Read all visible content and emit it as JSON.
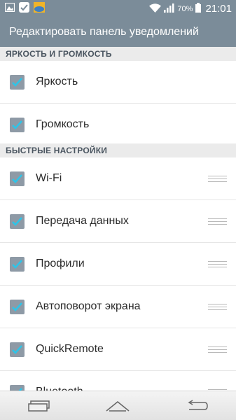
{
  "status_bar": {
    "battery": "70%",
    "time": "21:01",
    "left_icons": [
      "gallery-icon",
      "checkmark-app-icon",
      "weather-icon"
    ],
    "right_icons": [
      "wifi-icon",
      "signal-icon",
      "battery-icon"
    ]
  },
  "header": {
    "title": "Редактировать панель уведомлений"
  },
  "sections": [
    {
      "title": "ЯРКОСТЬ И ГРОМКОСТЬ",
      "items": [
        {
          "label": "Яркость",
          "checked": true
        },
        {
          "label": "Громкость",
          "checked": true
        }
      ]
    },
    {
      "title": "БЫСТРЫЕ НАСТРОЙКИ",
      "items": [
        {
          "label": "Wi-Fi",
          "checked": true
        },
        {
          "label": "Передача данных",
          "checked": true
        },
        {
          "label": "Профили",
          "checked": true
        },
        {
          "label": "Автоповорот экрана",
          "checked": true
        },
        {
          "label": "QuickRemote",
          "checked": true
        },
        {
          "label": "Bluetooth",
          "checked": true
        }
      ]
    }
  ],
  "nav_bar": {
    "buttons": [
      "recent-apps-icon",
      "home-icon",
      "back-icon"
    ]
  },
  "colors": {
    "check_mark": "#2ec4e8",
    "checkbox": "#8e9aa6",
    "header_bg": "#7b8c99"
  }
}
